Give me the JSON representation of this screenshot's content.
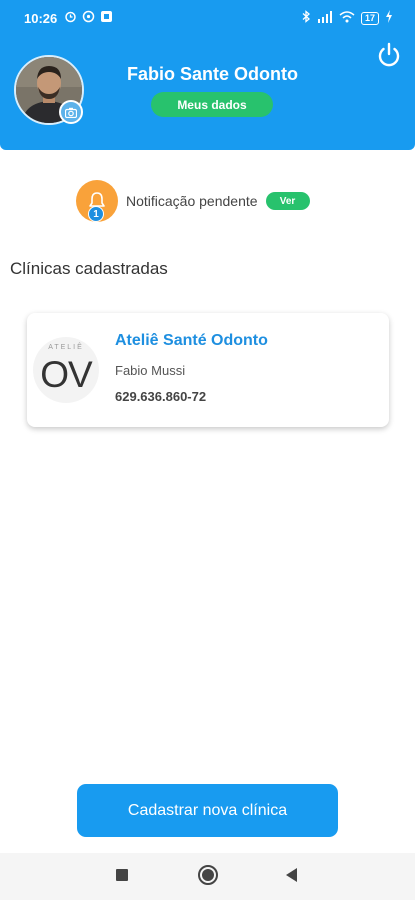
{
  "status_bar": {
    "time": "10:26",
    "battery": "17",
    "icons_left": [
      "alarm-icon",
      "whatsapp-icon",
      "app-icon"
    ],
    "icons_right": [
      "bluetooth-icon",
      "signal-icon",
      "wifi-icon",
      "battery-icon",
      "charging-icon"
    ]
  },
  "header": {
    "user_name": "Fabio Sante Odonto",
    "my_data_label": "Meus dados",
    "background_color": "#189bf0"
  },
  "notification": {
    "count": "1",
    "text": "Notificação pendente",
    "view_label": "Ver"
  },
  "clinics": {
    "section_title": "Clínicas cadastradas",
    "items": [
      {
        "logo_small_text": "ATELIÊ",
        "logo_big_text": "OV",
        "name": "Ateliê Santé Odonto",
        "person": "Fabio Mussi",
        "document": "629.636.860-72"
      }
    ]
  },
  "footer": {
    "new_clinic_label": "Cadastrar nova clínica"
  },
  "colors": {
    "primary": "#189bf0",
    "success": "#28c26d",
    "warning": "#f9a23a"
  }
}
